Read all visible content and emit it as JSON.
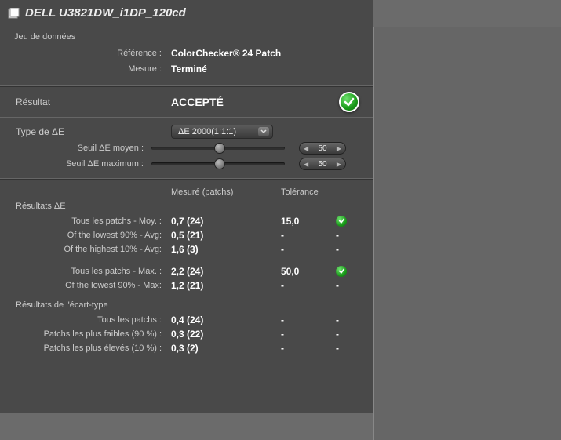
{
  "title": "DELL U3821DW_i1DP_120cd",
  "dataset": {
    "heading": "Jeu de données",
    "reference_label": "Référence :",
    "reference_value": "ColorChecker® 24 Patch",
    "measure_label": "Mesure :",
    "measure_value": "Terminé"
  },
  "result": {
    "label": "Résultat",
    "value": "ACCEPTÉ"
  },
  "de_type": {
    "label": "Type de ΔE",
    "selected": "ΔE 2000(1:1:1)"
  },
  "thresholds": {
    "avg_label": "Seuil ΔE moyen :",
    "avg_value": "50",
    "max_label": "Seuil ΔE maximum :",
    "max_value": "50"
  },
  "columns": {
    "measured": "Mesuré (patchs)",
    "tolerance": "Tolérance"
  },
  "de_results": {
    "heading": "Résultats ΔE",
    "rows_a": [
      {
        "label": "Tous les patchs - Moy. :",
        "measured": "0,7  (24)",
        "tolerance": "15,0",
        "pass": true
      },
      {
        "label": "Of the lowest 90% - Avg:",
        "measured": "0,5  (21)",
        "tolerance": "-",
        "pass": null
      },
      {
        "label": "Of the highest 10% - Avg:",
        "measured": "1,6  (3)",
        "tolerance": "-",
        "pass": null
      }
    ],
    "rows_b": [
      {
        "label": "Tous les patchs - Max. :",
        "measured": "2,2  (24)",
        "tolerance": "50,0",
        "pass": true
      },
      {
        "label": "Of the lowest 90% - Max:",
        "measured": "1,2  (21)",
        "tolerance": "-",
        "pass": null
      }
    ]
  },
  "std_results": {
    "heading": "Résultats de l'écart-type",
    "rows": [
      {
        "label": "Tous les patchs :",
        "measured": "0,4  (24)",
        "tolerance": "-",
        "pass": null
      },
      {
        "label": "Patchs les plus faibles (90 %) :",
        "measured": "0,3  (22)",
        "tolerance": "-",
        "pass": null
      },
      {
        "label": "Patchs les plus élevés (10 %) :",
        "measured": "0,3  (2)",
        "tolerance": "-",
        "pass": null
      }
    ]
  },
  "dash": "-"
}
